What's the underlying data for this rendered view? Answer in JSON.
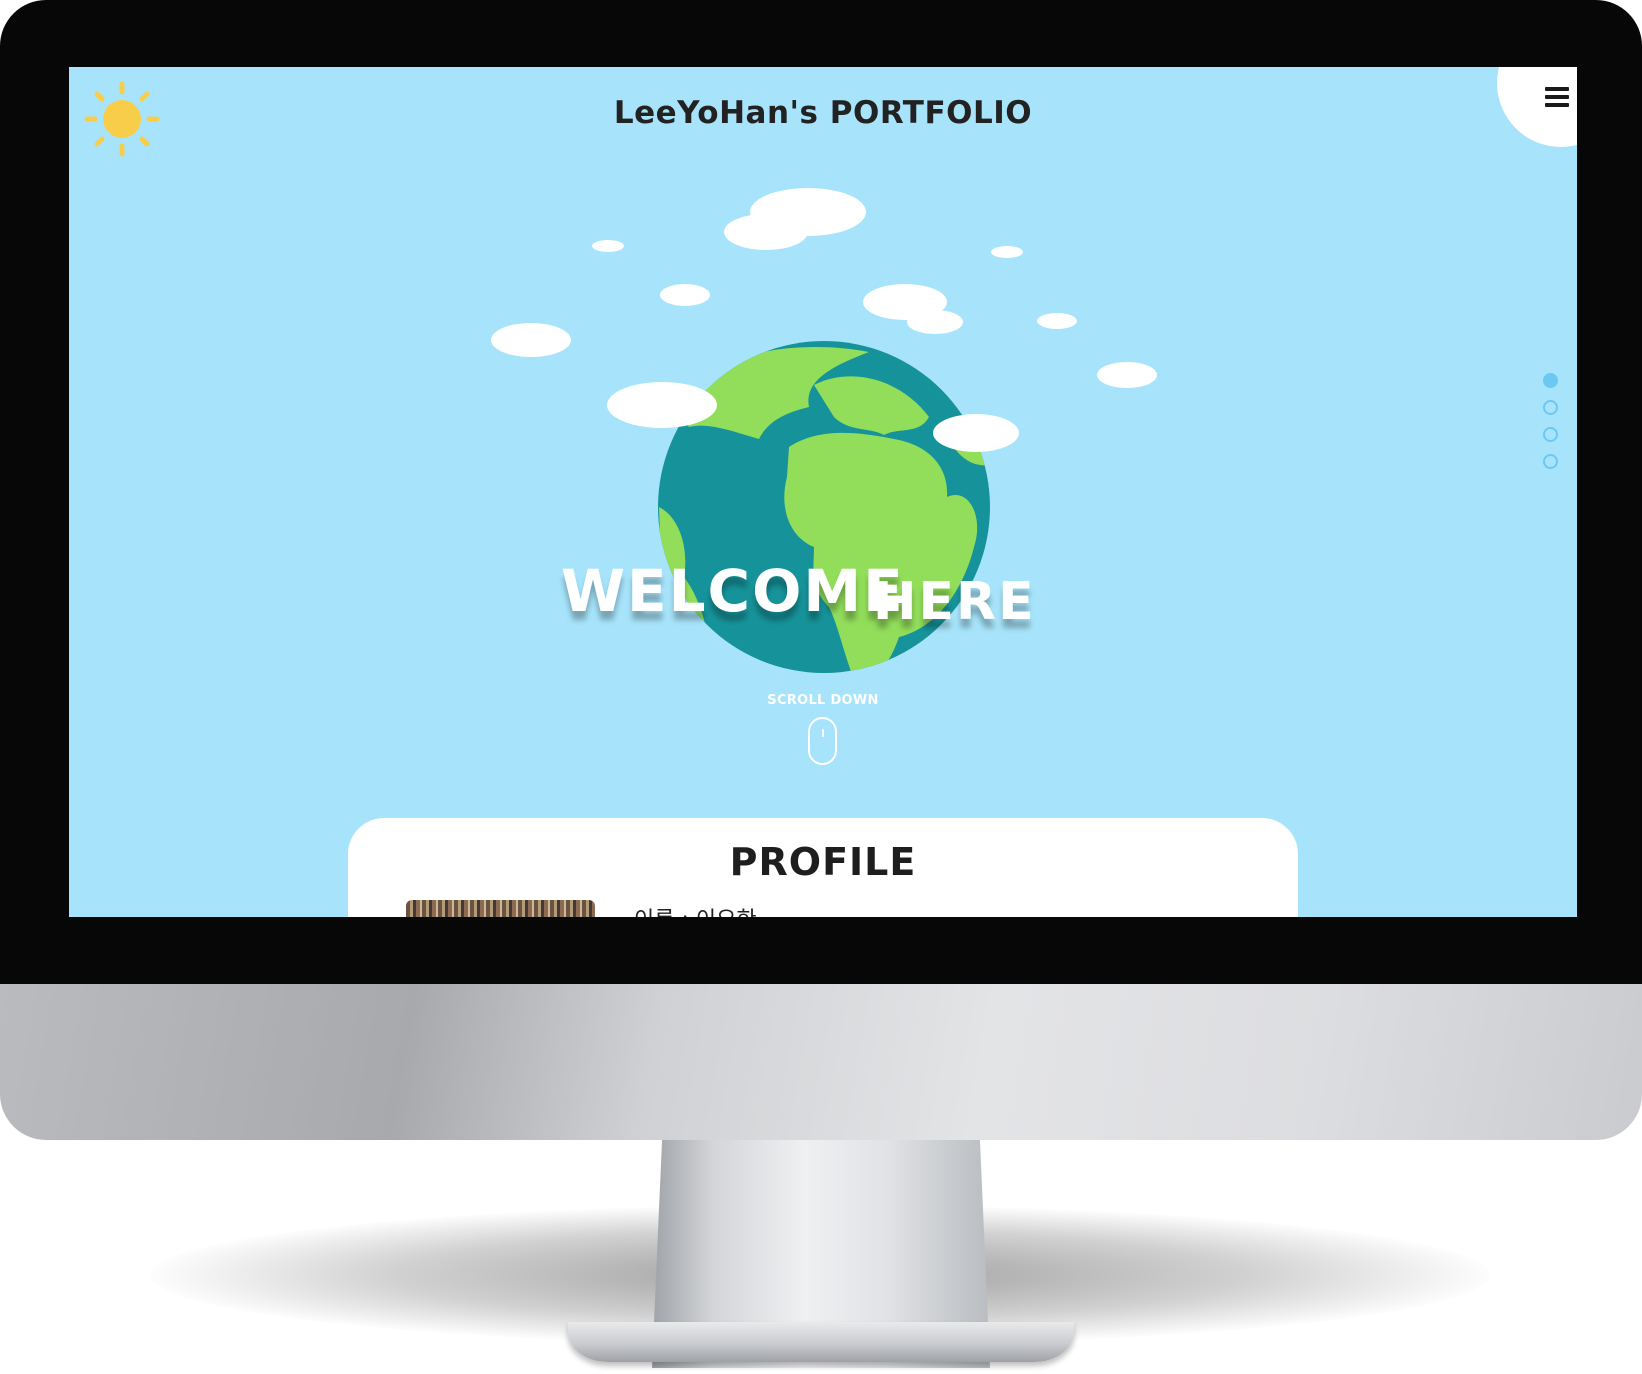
{
  "site": {
    "title": "LeeYoHan's PORTFOLIO"
  },
  "hero": {
    "welcome_word_1": "WELCOME",
    "welcome_word_2": "HERE",
    "scroll_label": "SCROLL DOWN"
  },
  "nav_dots": {
    "count": 4,
    "active_index": 0
  },
  "profile": {
    "title": "PROFILE",
    "name_line": "이름 : 이요한"
  },
  "icons": {
    "sun": "sun-icon",
    "menu": "hamburger-menu-icon",
    "mouse": "mouse-scroll-icon",
    "globe": "globe-illustration"
  },
  "colors": {
    "sky": "#a7e4fb",
    "ocean": "#16939a",
    "land": "#92de5a",
    "sun": "#f8cd4a",
    "dot_accent": "#6cc8f2",
    "bezel": "#070707"
  }
}
